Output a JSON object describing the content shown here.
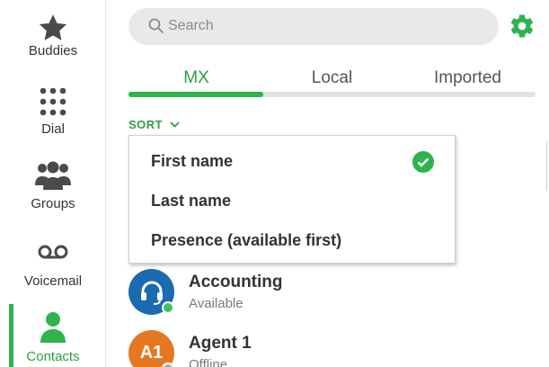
{
  "sidebar": {
    "items": [
      {
        "label": "Buddies",
        "icon": "star-icon"
      },
      {
        "label": "Dial",
        "icon": "dialpad-icon"
      },
      {
        "label": "Groups",
        "icon": "group-icon"
      },
      {
        "label": "Voicemail",
        "icon": "voicemail-icon"
      },
      {
        "label": "Contacts",
        "icon": "person-icon",
        "active": true
      }
    ]
  },
  "search": {
    "placeholder": "Search",
    "value": ""
  },
  "tabs": [
    {
      "label": "MX",
      "active": true
    },
    {
      "label": "Local",
      "active": false
    },
    {
      "label": "Imported",
      "active": false
    }
  ],
  "sort": {
    "label": "SORT"
  },
  "sort_menu": {
    "items": [
      {
        "label": "First name",
        "selected": true
      },
      {
        "label": "Last name",
        "selected": false
      },
      {
        "label": "Presence (available first)",
        "selected": false
      }
    ]
  },
  "contacts": [
    {
      "name": "Accounting",
      "status": "Available",
      "avatar_text": "",
      "avatar_color": "#1a6bb0",
      "status_color": "#3cc35a",
      "icon": "headset-icon"
    },
    {
      "name": "Agent 1",
      "status": "Offline",
      "avatar_text": "A1",
      "avatar_color": "#e67722",
      "status_color": "#a8a8a8"
    }
  ],
  "colors": {
    "accent": "#2fb34d",
    "accent_text": "#2e9e3e",
    "icon_gray": "#4a4a4a"
  }
}
